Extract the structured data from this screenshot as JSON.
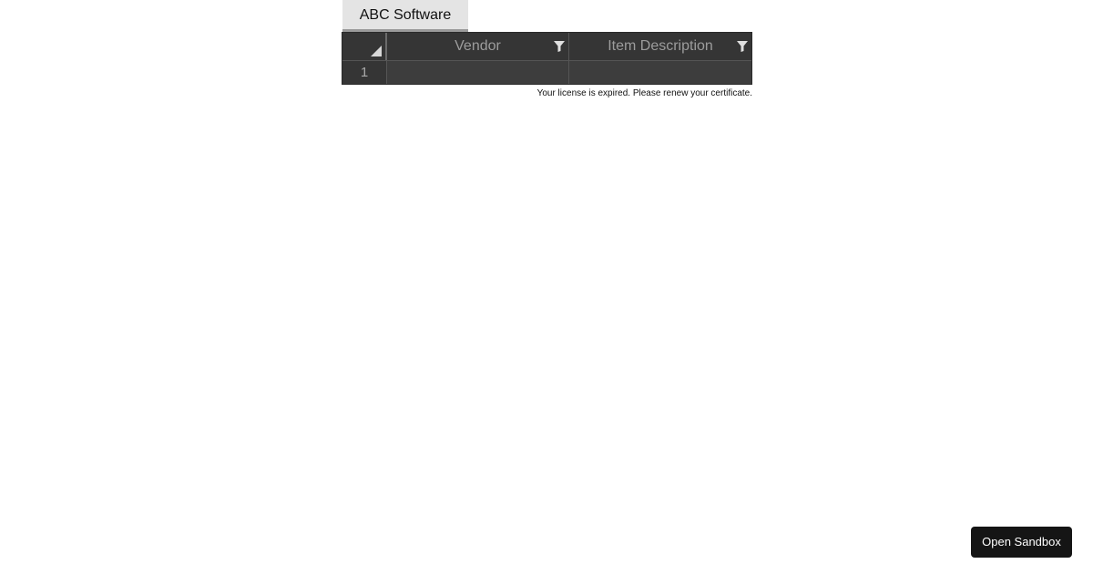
{
  "tabs": [
    {
      "label": "ABC Software"
    }
  ],
  "grid": {
    "columns": [
      {
        "label": "Vendor",
        "filter_icon": "filter-icon"
      },
      {
        "label": "Item Description",
        "filter_icon": "filter-icon"
      }
    ],
    "rows": [
      {
        "row_number": "1",
        "cells": [
          "",
          ""
        ]
      }
    ]
  },
  "license_notice": "Your license is expired. Please renew your certificate.",
  "sandbox_button": {
    "label": "Open Sandbox"
  },
  "colors": {
    "header_bg": "#353535",
    "cell_bg": "#3d3d3d",
    "header_text": "#9c9c9c",
    "button_bg": "#151515"
  }
}
